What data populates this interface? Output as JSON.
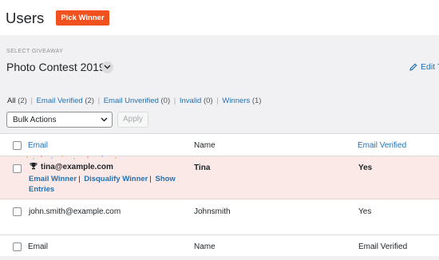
{
  "header": {
    "title": "Users",
    "pick_winner_label": "Pick Winner"
  },
  "giveaway": {
    "select_label": "SELECT GIVEAWAY",
    "selected": "Photo Contest 2019",
    "edit_label": "Edit T"
  },
  "filters": {
    "all": {
      "label": "All",
      "count": "(2)"
    },
    "email_verified": {
      "label": "Email Verified",
      "count": "(2)"
    },
    "email_unverified": {
      "label": "Email Unverified",
      "count": "(0)"
    },
    "invalid": {
      "label": "Invalid",
      "count": "(0)"
    },
    "winners": {
      "label": "Winners",
      "count": "(1)"
    },
    "separator": "|"
  },
  "bulk": {
    "select_value": "Bulk Actions",
    "apply_label": "Apply"
  },
  "table": {
    "headers": {
      "email": "Email",
      "name": "Name",
      "email_verified": "Email Verified"
    },
    "footers": {
      "email": "Email",
      "name": "Name",
      "email_verified": "Email Verified"
    },
    "rows": [
      {
        "email": "tina@example.com",
        "name": "Tina",
        "verified": "Yes",
        "actions": {
          "email_winner": "Email Winner",
          "disqualify": "Disqualify Winner",
          "show_entries": "Show Entries"
        }
      },
      {
        "email": "john.smith@example.com",
        "name": "Johnsmith",
        "verified": "Yes"
      }
    ]
  },
  "colors": {
    "accent": "#f0511e",
    "link": "#2271b1",
    "winner_row_bg": "#fbe9e7"
  },
  "icons": [
    "chevron-down-icon",
    "edit-pencil-icon",
    "trophy-icon",
    "confetti-icon"
  ]
}
